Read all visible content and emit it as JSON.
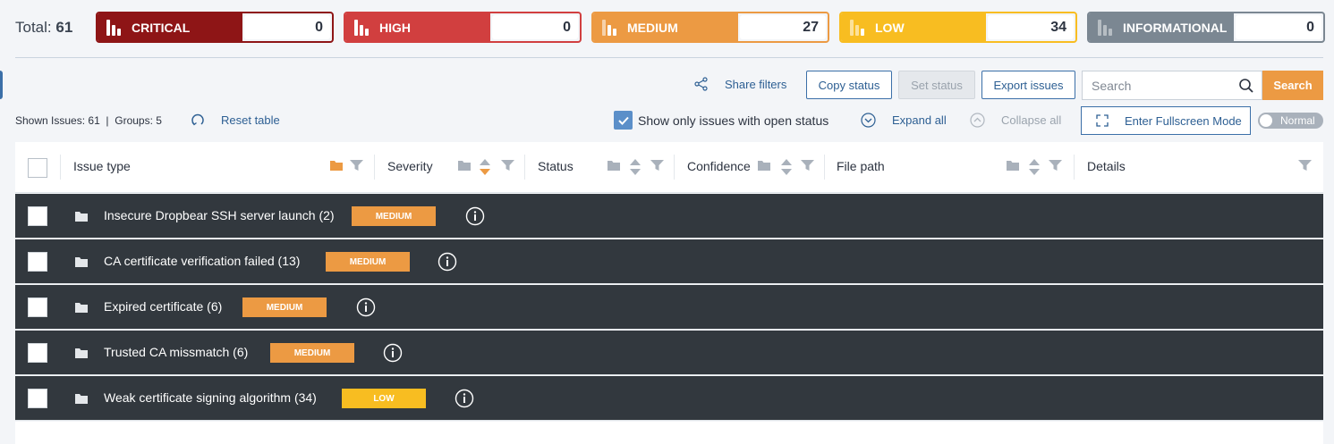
{
  "summary": {
    "total_label": "Total:",
    "total_value": "61",
    "cards": [
      {
        "key": "critical",
        "label": "CRITICAL",
        "count": "0"
      },
      {
        "key": "high",
        "label": "HIGH",
        "count": "0"
      },
      {
        "key": "medium",
        "label": "MEDIUM",
        "count": "27"
      },
      {
        "key": "low",
        "label": "LOW",
        "count": "34"
      },
      {
        "key": "informational",
        "label": "INFORMATIONAL",
        "count": "0"
      }
    ]
  },
  "toolbar": {
    "share_filters": "Share filters",
    "copy_status": "Copy status",
    "set_status": "Set status",
    "export_issues": "Export issues",
    "search_placeholder": "Search",
    "search_button": "Search",
    "shown_issues_label": "Shown Issues:",
    "shown_issues_value": "61",
    "groups_label": "Groups:",
    "groups_value": "5",
    "reset_table": "Reset table",
    "open_status_label": "Show only issues with open status",
    "expand_all": "Expand all",
    "collapse_all": "Collapse all",
    "fullscreen": "Enter Fullscreen Mode",
    "view_mode": "Normal"
  },
  "table": {
    "columns": [
      "Issue type",
      "Severity",
      "Status",
      "Confidence",
      "File path",
      "Details"
    ],
    "rows": [
      {
        "issue": "Insecure Dropbear SSH server launch (2)",
        "severity": "MEDIUM",
        "level": "medium"
      },
      {
        "issue": "CA certificate verification failed (13)",
        "severity": "MEDIUM",
        "level": "medium"
      },
      {
        "issue": "Expired certificate (6)",
        "severity": "MEDIUM",
        "level": "medium"
      },
      {
        "issue": "Trusted CA missmatch (6)",
        "severity": "MEDIUM",
        "level": "medium"
      },
      {
        "issue": "Weak certificate signing algorithm (34)",
        "severity": "LOW",
        "level": "low"
      }
    ]
  },
  "colors": {
    "critical": "#8e1516",
    "high": "#d13f3f",
    "medium": "#ec9a43",
    "low": "#f8bd21",
    "informational": "#7b8792",
    "row_bg": "#32383e",
    "link": "#2d5f93"
  }
}
